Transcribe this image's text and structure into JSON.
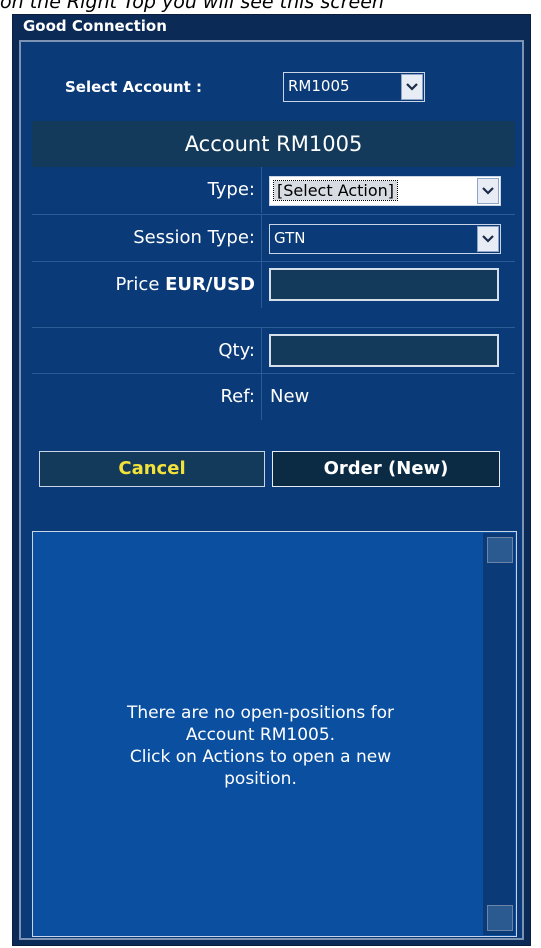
{
  "caption": "on the Right Top you will see this screen",
  "window": {
    "title": "Good Connection"
  },
  "account_select": {
    "label": "Select Account :",
    "value": "RM1005"
  },
  "order_panel": {
    "header": "Account RM1005",
    "type": {
      "label": "Type:",
      "value": "[Select Action]"
    },
    "session_type": {
      "label": "Session Type:",
      "value": "GTN"
    },
    "price": {
      "label_prefix": "Price ",
      "label_pair": "EUR/USD",
      "value": ""
    },
    "qty": {
      "label": "Qty:",
      "value": ""
    },
    "ref": {
      "label": "Ref:",
      "value": "New"
    },
    "cancel_label": "Cancel",
    "order_label": "Order (New)"
  },
  "positions": {
    "message_line1": "There are no open-positions for",
    "message_line2": "Account RM1005.",
    "message_line3": "Click on Actions to open a new",
    "message_line4": "position."
  }
}
